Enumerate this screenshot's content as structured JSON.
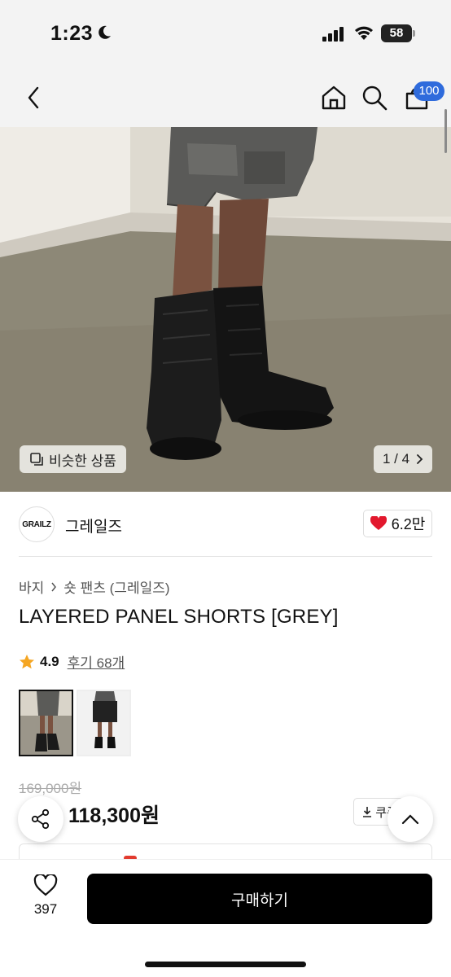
{
  "status_bar": {
    "time": "1:23",
    "battery": "58",
    "icons": [
      "moon-icon",
      "signal-icon",
      "wifi-icon",
      "battery-icon"
    ]
  },
  "header": {
    "icons": [
      "back-icon",
      "home-icon",
      "search-icon",
      "cart-icon"
    ],
    "cart_badge": "100",
    "badge_color": "#2f6bdc"
  },
  "gallery": {
    "similar_label": "비슷한 상품",
    "page_counter": "1 / 4"
  },
  "brand": {
    "logo_text": "GRAILZ",
    "name": "그레일즈",
    "likes": "6.2만",
    "heart_color": "#e2182d"
  },
  "product": {
    "breadcrumb": [
      "바지",
      "숏 팬츠 (그레일즈)"
    ],
    "title": "LAYERED PANEL SHORTS [GREY]",
    "rating": "4.9",
    "review_label": "후기 68개",
    "original_price": "169,000원",
    "sale_price": "118,300원",
    "coupon_label": "쿠폰",
    "discount_color": "#e23a2e"
  },
  "bottom_bar": {
    "wish_count": "397",
    "buy_label": "구매하기"
  }
}
